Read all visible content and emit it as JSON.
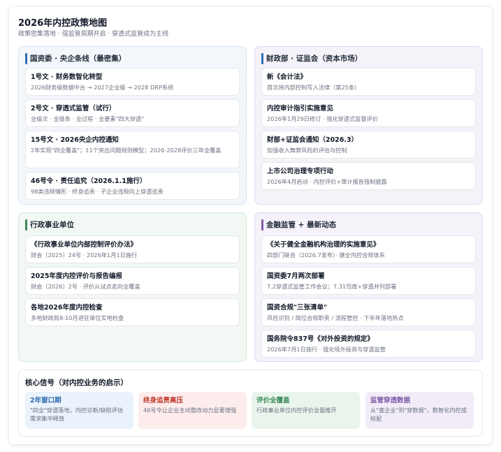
{
  "header": {
    "title": "2026年内控政策地图",
    "subtitle": "政策密集落地 · 强监管周期开启 · 穿透式监管成为主线"
  },
  "panels": {
    "sasac": {
      "title": "国资委 · 央企条线（最密集）",
      "items": [
        {
          "title": "1号文 · 财务数智化转型",
          "desc": "2026财务级数据中台 → 2027企业级 → 2028 DRP系统"
        },
        {
          "title": "2号文 · 穿透式监管（试行）",
          "desc": "全级次 · 全链条 · 全过程 · 全要素\"四大穿透\""
        },
        {
          "title": "15号文 · 2026央企内控通知",
          "desc": "2年实现\"四全覆盖\"；11个突出问题规则模型；2026-2028评价三年全覆盖"
        },
        {
          "title": "46号令 · 责任追究（2026.1.1施行）",
          "desc": "98类违规情形 · 终身追责 · 子企业违规向上穿透追责"
        }
      ]
    },
    "mof": {
      "title": "财政部 · 证监会（资本市场）",
      "items": [
        {
          "title": "新《会计法》",
          "desc": "首次将内部控制写入法律（第25条）"
        },
        {
          "title": "内控审计指引实施意见",
          "desc": "2026年1月29日修订 · 强化穿透式监督评价"
        },
        {
          "title": "财部+证监会通知（2026.3）",
          "desc": "加强收入舞弊风险的评估与控制"
        },
        {
          "title": "上市公司治理专项行动",
          "desc": "2026年4月启动 · 内控评价+审计报告强制披露"
        }
      ]
    },
    "admin": {
      "title": "行政事业单位",
      "items": [
        {
          "title": "《行政事业单位内部控制评价办法》",
          "desc": "财会〔2025〕24号 · 2026年1月1日施行"
        },
        {
          "title": "2025年度内控评价与报告编报",
          "desc": "财会〔2026〕2号 · 评价从试点走向全覆盖"
        },
        {
          "title": "各地2026年度内控检查",
          "desc": "多地财政局8-10月进驻单位实地检查"
        }
      ]
    },
    "finance": {
      "title": "金融监管 + 最新动态",
      "items": [
        {
          "title": "《关于健全金融机构治理的实施意见》",
          "desc": "四部门联合（2026.7发布）· 健全内控合规体系"
        },
        {
          "title": "国资委7月两次部署",
          "desc": "7.2穿透式监管工作会议；7.31司库+穿透并列部署"
        },
        {
          "title": "国资合规\"三张清单\"",
          "desc": "风险识别 / 岗位合规职责 / 流程管控 · 下半年落地热点"
        },
        {
          "title": "国务院令837号《对外投资的规定》",
          "desc": "2026年7月1日施行 · 强化境外投资与穿透监管"
        }
      ]
    }
  },
  "signals": {
    "title": "核心信号（对内控业务的启示）",
    "items": [
      {
        "title": "2年窗口期",
        "desc": "\"四全\"穿透落地，内控诊断/缺陷评估需求集中释放"
      },
      {
        "title": "终身追责高压",
        "desc": "46号令让企业主动整改动力显著增强"
      },
      {
        "title": "评价全覆盖",
        "desc": "行政事业单位内控评价全面推开"
      },
      {
        "title": "监管穿透数据",
        "desc": "从\"查企业\"到\"穿数据\"，数智化内控成标配"
      }
    ]
  },
  "colors": {
    "blue": "#2f6fb0",
    "green": "#3f8a57",
    "purple": "#7f5aa8",
    "red": "#c0392b"
  }
}
